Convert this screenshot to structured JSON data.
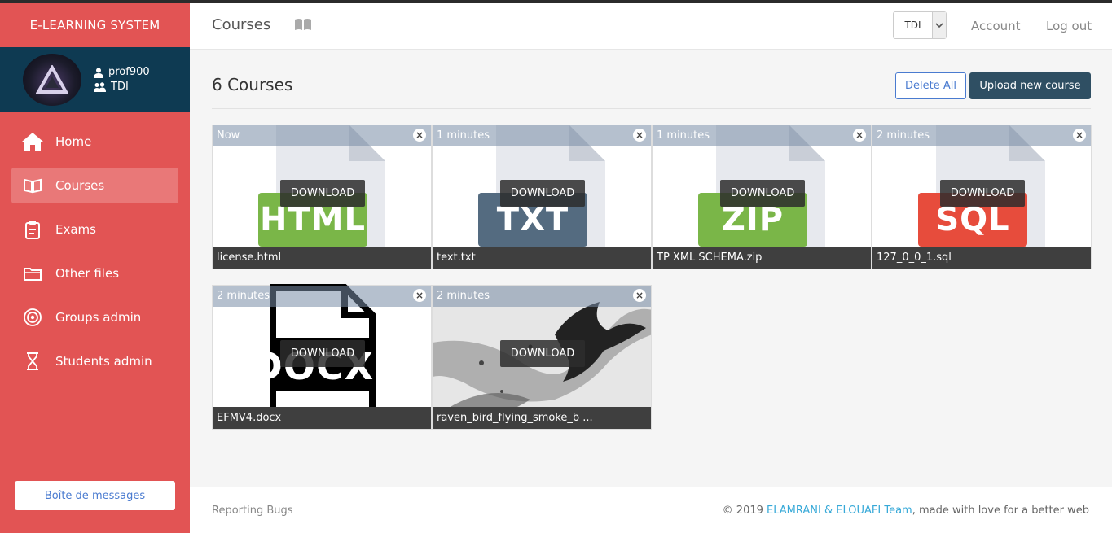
{
  "brand": "E-LEARNING SYSTEM",
  "user": {
    "name": "prof900",
    "group": "TDI"
  },
  "nav": [
    {
      "label": "Home",
      "icon": "home-icon",
      "active": false
    },
    {
      "label": "Courses",
      "icon": "book-icon",
      "active": true
    },
    {
      "label": "Exams",
      "icon": "clipboard-icon",
      "active": false
    },
    {
      "label": "Other files",
      "icon": "folders-icon",
      "active": false
    },
    {
      "label": "Groups admin",
      "icon": "target-icon",
      "active": false
    },
    {
      "label": "Students admin",
      "icon": "hourglass-icon",
      "active": false
    }
  ],
  "messages_button": "Boîte de messages",
  "header": {
    "title": "Courses",
    "group_select": "TDI",
    "account": "Account",
    "logout": "Log out"
  },
  "main": {
    "count_title": "6 Courses",
    "delete_all": "Delete All",
    "upload": "Upload new course"
  },
  "cards": [
    {
      "time": "Now",
      "ext": "HTML",
      "ext_color": "#7ab648",
      "name": "license.html",
      "download": "DOWNLOAD"
    },
    {
      "time": "1 minutes",
      "ext": "TXT",
      "ext_color": "#546b80",
      "name": "text.txt",
      "download": "DOWNLOAD"
    },
    {
      "time": "1 minutes",
      "ext": "ZIP",
      "ext_color": "#7ab648",
      "name": "TP XML SCHEMA.zip",
      "download": "DOWNLOAD"
    },
    {
      "time": "2 minutes",
      "ext": "SQL",
      "ext_color": "#e74c3c",
      "name": "127_0_0_1.sql",
      "download": "DOWNLOAD"
    },
    {
      "time": "2 minutes",
      "ext": "DOCX",
      "ext_color": "#000000",
      "name": "EFMV4.docx",
      "download": "DOWNLOAD"
    },
    {
      "time": "2 minutes",
      "ext": "",
      "ext_color": "",
      "name": "raven_bird_flying_smoke_b ...",
      "download": "DOWNLOAD"
    }
  ],
  "footer": {
    "report": "Reporting Bugs",
    "copy_prefix": "© 2019",
    "team": "ELAMRANI & ELOUAFI Team",
    "copy_suffix": ", made with love for a better web"
  }
}
